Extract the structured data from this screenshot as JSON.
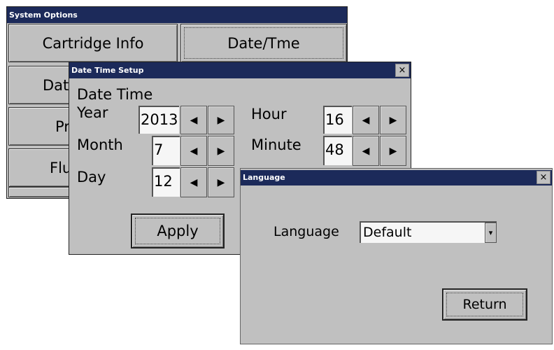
{
  "system_options": {
    "title": "System Options",
    "buttons": [
      "Cartridge Info",
      "Date/Tme",
      "Data",
      "Pr",
      "Flu"
    ]
  },
  "date_time_setup": {
    "title": "Date Time Setup",
    "close": "×",
    "heading": "Date Time",
    "fields": [
      {
        "label": "Year",
        "value": "2013"
      },
      {
        "label": "Month",
        "value": "7"
      },
      {
        "label": "Day",
        "value": "12"
      },
      {
        "label": "Hour",
        "value": "16"
      },
      {
        "label": "Minute",
        "value": "48"
      }
    ],
    "decrement_icon": "◀",
    "increment_icon": "▶",
    "apply_label": "Apply"
  },
  "language_dialog": {
    "title": "Language",
    "close": "×",
    "label": "Language",
    "selected": "Default",
    "dropdown_icon": "▾",
    "return_label": "Return"
  }
}
